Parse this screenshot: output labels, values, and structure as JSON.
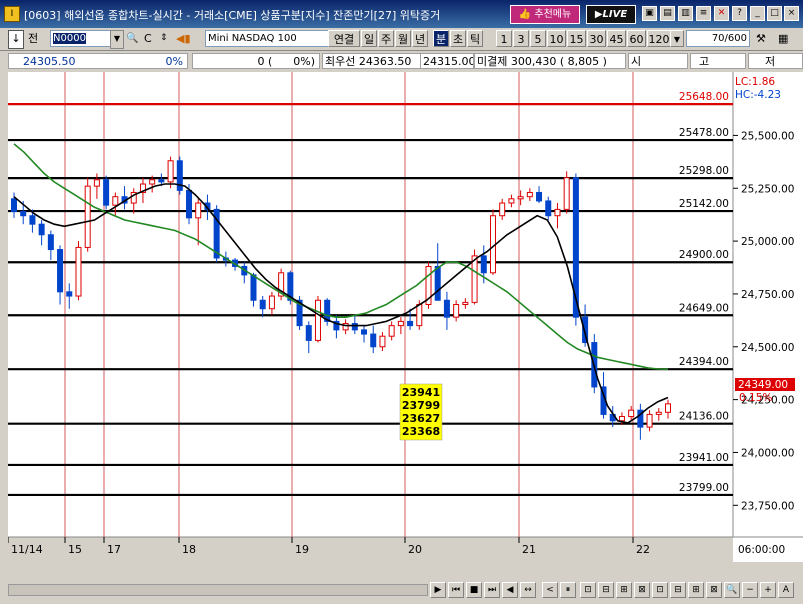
{
  "window": {
    "title": "[0603] 해외선옵 종합차트-실시간 - 거래소[CME] 상품구분[지수] 잔존만기[27] 위탁증거",
    "menu_label": "추천메뉴",
    "live_label": "LIVE"
  },
  "toolbar": {
    "prev_label": "전",
    "code": "N0000",
    "product_name": "Mini NASDAQ 100",
    "periods": [
      "연결",
      "일",
      "주",
      "월",
      "년",
      "분",
      "초",
      "틱"
    ],
    "active_period": "분",
    "intervals": [
      "1",
      "3",
      "5",
      "10",
      "15",
      "30",
      "45",
      "60",
      "120"
    ],
    "count": "70/600"
  },
  "quote": {
    "price": "24305.50",
    "pct": "0%",
    "change": "0 (",
    "change_pct": "0%)",
    "best_bid_label": "최우선",
    "best_bid": "24363.50",
    "best_ask": "24315.00",
    "unsettled_label": "미결제",
    "unsettled": "300,430 ( 8,805 )",
    "open_label": "시",
    "high_label": "고",
    "low_label": "저"
  },
  "chart_data": {
    "type": "candlestick",
    "x_ticks": [
      "11/14",
      "15",
      "17",
      "18",
      "19",
      "20",
      "21",
      "22"
    ],
    "y_ticks": [
      25500,
      25250,
      25000,
      24750,
      24500,
      24250,
      24000,
      23750
    ],
    "ylim": [
      23600,
      25800
    ],
    "lc_label": "LC:1.86",
    "hc_label": "HC:-4.23",
    "current_price": "24349.00",
    "current_pct": "0.15%",
    "time_label": "06:00:00",
    "levels": [
      {
        "value": 25648,
        "label": "25648.00",
        "color": "#dd0000"
      },
      {
        "value": 25478,
        "label": "25478.00",
        "color": "#000000"
      },
      {
        "value": 25298,
        "label": "25298.00",
        "color": "#000000"
      },
      {
        "value": 25142,
        "label": "25142.00",
        "color": "#000000"
      },
      {
        "value": 24900,
        "label": "24900.00",
        "color": "#000000"
      },
      {
        "value": 24649,
        "label": "24649.00",
        "color": "#000000"
      },
      {
        "value": 24394,
        "label": "24394.00",
        "color": "#000000"
      },
      {
        "value": 24136,
        "label": "24136.00",
        "color": "#000000"
      },
      {
        "value": 23941,
        "label": "23941.00",
        "color": "#000000"
      },
      {
        "value": 23799,
        "label": "23799.00",
        "color": "#000000"
      }
    ],
    "annotation_box": [
      "23941",
      "23799",
      "23627",
      "23368"
    ],
    "candles": [
      [
        25200,
        25230,
        25110,
        25140
      ],
      [
        25140,
        25190,
        25080,
        25120
      ],
      [
        25120,
        25150,
        25040,
        25080
      ],
      [
        25080,
        25100,
        24980,
        25030
      ],
      [
        25030,
        25050,
        24910,
        24960
      ],
      [
        24960,
        24980,
        24700,
        24760
      ],
      [
        24760,
        24800,
        24680,
        24740
      ],
      [
        24740,
        25000,
        24720,
        24970
      ],
      [
        24970,
        25300,
        24950,
        25260
      ],
      [
        25260,
        25320,
        25200,
        25290
      ],
      [
        25290,
        25310,
        25150,
        25170
      ],
      [
        25170,
        25230,
        25120,
        25210
      ],
      [
        25210,
        25260,
        25150,
        25180
      ],
      [
        25180,
        25250,
        25130,
        25230
      ],
      [
        25230,
        25300,
        25180,
        25270
      ],
      [
        25270,
        25310,
        25230,
        25290
      ],
      [
        25290,
        25320,
        25260,
        25280
      ],
      [
        25280,
        25400,
        25250,
        25380
      ],
      [
        25380,
        25400,
        25220,
        25240
      ],
      [
        25240,
        25270,
        25080,
        25110
      ],
      [
        25110,
        25200,
        24980,
        25180
      ],
      [
        25180,
        25220,
        25100,
        25150
      ],
      [
        25150,
        25170,
        24900,
        24920
      ],
      [
        24920,
        24950,
        24880,
        24910
      ],
      [
        24910,
        24920,
        24860,
        24880
      ],
      [
        24880,
        24900,
        24800,
        24840
      ],
      [
        24840,
        24850,
        24690,
        24720
      ],
      [
        24720,
        24740,
        24640,
        24680
      ],
      [
        24680,
        24760,
        24650,
        24740
      ],
      [
        24740,
        24870,
        24720,
        24850
      ],
      [
        24850,
        24860,
        24700,
        24720
      ],
      [
        24720,
        24740,
        24580,
        24600
      ],
      [
        24600,
        24620,
        24470,
        24530
      ],
      [
        24530,
        24740,
        24520,
        24720
      ],
      [
        24720,
        24730,
        24600,
        24620
      ],
      [
        24620,
        24650,
        24540,
        24580
      ],
      [
        24580,
        24630,
        24560,
        24610
      ],
      [
        24610,
        24650,
        24560,
        24580
      ],
      [
        24580,
        24600,
        24520,
        24560
      ],
      [
        24560,
        24600,
        24470,
        24500
      ],
      [
        24500,
        24570,
        24480,
        24550
      ],
      [
        24550,
        24620,
        24530,
        24600
      ],
      [
        24600,
        24640,
        24560,
        24620
      ],
      [
        24620,
        24680,
        24580,
        24600
      ],
      [
        24600,
        24720,
        24580,
        24700
      ],
      [
        24700,
        24900,
        24680,
        24880
      ],
      [
        24880,
        24990,
        24860,
        24720
      ],
      [
        24720,
        24760,
        24580,
        24640
      ],
      [
        24640,
        24720,
        24620,
        24700
      ],
      [
        24700,
        24730,
        24680,
        24710
      ],
      [
        24710,
        24960,
        24700,
        24930
      ],
      [
        24930,
        24980,
        24800,
        24850
      ],
      [
        24850,
        25150,
        24840,
        25120
      ],
      [
        25120,
        25200,
        25100,
        25180
      ],
      [
        25180,
        25220,
        25160,
        25200
      ],
      [
        25200,
        25240,
        25170,
        25210
      ],
      [
        25210,
        25250,
        25190,
        25230
      ],
      [
        25230,
        25260,
        25180,
        25190
      ],
      [
        25190,
        25210,
        25100,
        25120
      ],
      [
        25120,
        25180,
        25060,
        25150
      ],
      [
        25150,
        25330,
        25130,
        25300
      ],
      [
        25300,
        25320,
        24600,
        24640
      ],
      [
        24640,
        24700,
        24500,
        24520
      ],
      [
        24520,
        24560,
        24280,
        24310
      ],
      [
        24310,
        24380,
        24160,
        24180
      ],
      [
        24180,
        24220,
        24120,
        24150
      ],
      [
        24150,
        24190,
        24130,
        24170
      ],
      [
        24170,
        24220,
        24150,
        24200
      ],
      [
        24200,
        24230,
        24060,
        24120
      ],
      [
        24120,
        24200,
        24100,
        24180
      ],
      [
        24180,
        24210,
        24150,
        24190
      ],
      [
        24190,
        24250,
        24160,
        24230
      ]
    ],
    "ma_short": [
      25210,
      25170,
      25130,
      25100,
      25080,
      25070,
      25080,
      25090,
      25100,
      25130,
      25160,
      25190,
      25220,
      25240,
      25260,
      25270,
      25270,
      25260,
      25220,
      25170,
      25110,
      25050,
      24990,
      24930,
      24870,
      24820,
      24780,
      24750,
      24720,
      24690,
      24660,
      24630,
      24610,
      24600,
      24600,
      24600,
      24610,
      24620,
      24640,
      24660,
      24690,
      24720,
      24760,
      24800,
      24840,
      24880,
      24920,
      24950,
      24990,
      25030,
      25060,
      25090,
      25120,
      25100,
      25020,
      24880,
      24700,
      24520,
      24350,
      24220,
      24150,
      24140,
      24170,
      24210,
      24240,
      24260
    ],
    "ma_long": [
      25460,
      25420,
      25370,
      25320,
      25280,
      25250,
      25220,
      25190,
      25160,
      25140,
      25120,
      25100,
      25090,
      25080,
      25070,
      25060,
      25050,
      25030,
      25010,
      24980,
      24950,
      24920,
      24890,
      24860,
      24830,
      24800,
      24770,
      24740,
      24710,
      24690,
      24670,
      24650,
      24640,
      24640,
      24650,
      24660,
      24680,
      24700,
      24730,
      24760,
      24790,
      24830,
      24870,
      24900,
      24900,
      24880,
      24850,
      24820,
      24790,
      24760,
      24720,
      24680,
      24640,
      24600,
      24560,
      24520,
      24490,
      24470,
      24450,
      24440,
      24430,
      24420,
      24410,
      24400,
      24395,
      24394
    ]
  }
}
